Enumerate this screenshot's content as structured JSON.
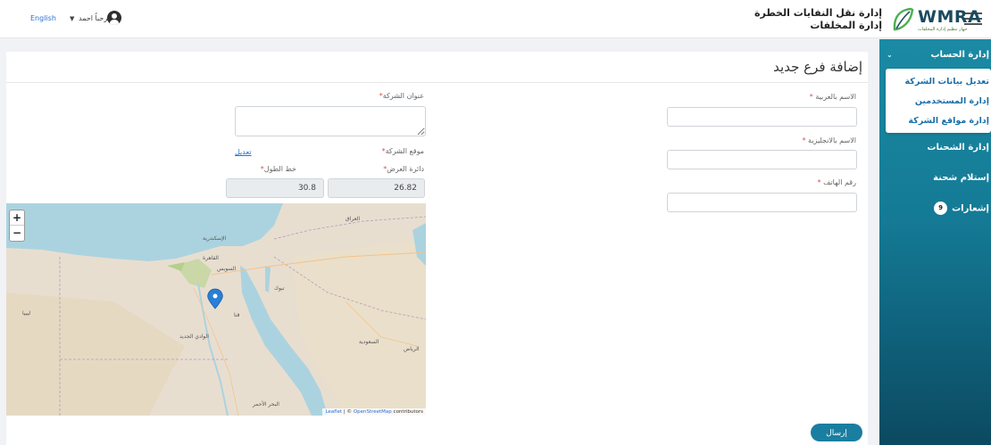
{
  "header": {
    "org_line1": "إدارة نقل النفايات الخطرة",
    "org_line2": "إدارة المخلفات",
    "logo_text": "WMRA",
    "logo_sub": "جهاز تنظيم إدارة المخلفات",
    "language": "English",
    "greeting": "مرحباً احمد",
    "icons": {
      "menu": "hamburger-icon",
      "avatar": "user-circle-icon",
      "chevron": "chevron-down-icon"
    }
  },
  "sidebar": {
    "account": "إدارة الحساب",
    "submenu": [
      "تعديل بيانات الشركة",
      "إدارة المستخدمين",
      "إدارة مواقع الشركة"
    ],
    "shipments": "إدارة الشحنات",
    "receive": "إستلام شحنة",
    "notifications": "إشعارات",
    "notifications_count": "9"
  },
  "form": {
    "title": "إضافة فرع جديد",
    "name_ar_label": "الاسم بالعربية",
    "name_en_label": "الاسم بالانجليزية",
    "phone_label": "رقم الهاتف",
    "address_label": "عنوان الشركة",
    "location_label": "موقع الشركة",
    "edit_link": "تعديل",
    "lat_label": "دائرة العرض",
    "lng_label": "خط الطول",
    "lat_value": "26.82",
    "lng_value": "30.8",
    "required_mark": "*",
    "submit": "إرسال"
  },
  "map": {
    "zoom_in": "+",
    "zoom_out": "−",
    "attribution_leaflet": "Leaflet",
    "attribution_sep": " | © ",
    "attribution_osm": "OpenStreetMap",
    "attribution_rest": " contributors",
    "labels": {
      "cairo": "القاهرة",
      "alexandria": "الإسكندرية",
      "suez": "السويس",
      "tabuk": "تبوك",
      "iraq": "العراق",
      "riyadh": "الرياض",
      "saudi": "السعودية",
      "qena": "قنا",
      "new_valley": "الوادي الجديد",
      "libya": "ليبيا",
      "red_sea": "البحر الأحمر"
    }
  },
  "colors": {
    "brand": "#1a7ea0",
    "sidebar_top": "#1b8aa4",
    "sidebar_bottom": "#0b4a60",
    "link": "#2a6fd6",
    "required": "#d9534f"
  }
}
